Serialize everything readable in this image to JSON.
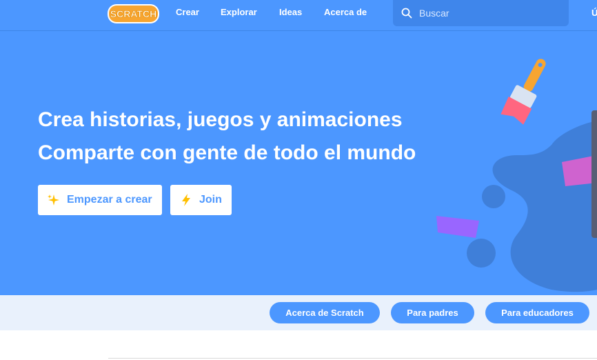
{
  "nav": {
    "logo_text": "SCRATCH",
    "links": [
      "Crear",
      "Explorar",
      "Ideas",
      "Acerca de"
    ],
    "search_placeholder": "Buscar",
    "cut_item": "Ú"
  },
  "hero": {
    "line1": "Crea historias, juegos y animaciones",
    "line2": "Comparte con gente de todo el mundo",
    "start_label": "Empezar a crear",
    "join_label": "Join"
  },
  "subnav": {
    "pills": [
      "Acerca de Scratch",
      "Para padres",
      "Para educadores"
    ]
  },
  "colors": {
    "brand_blue": "#4c97ff",
    "logo_orange": "#f7a531"
  }
}
